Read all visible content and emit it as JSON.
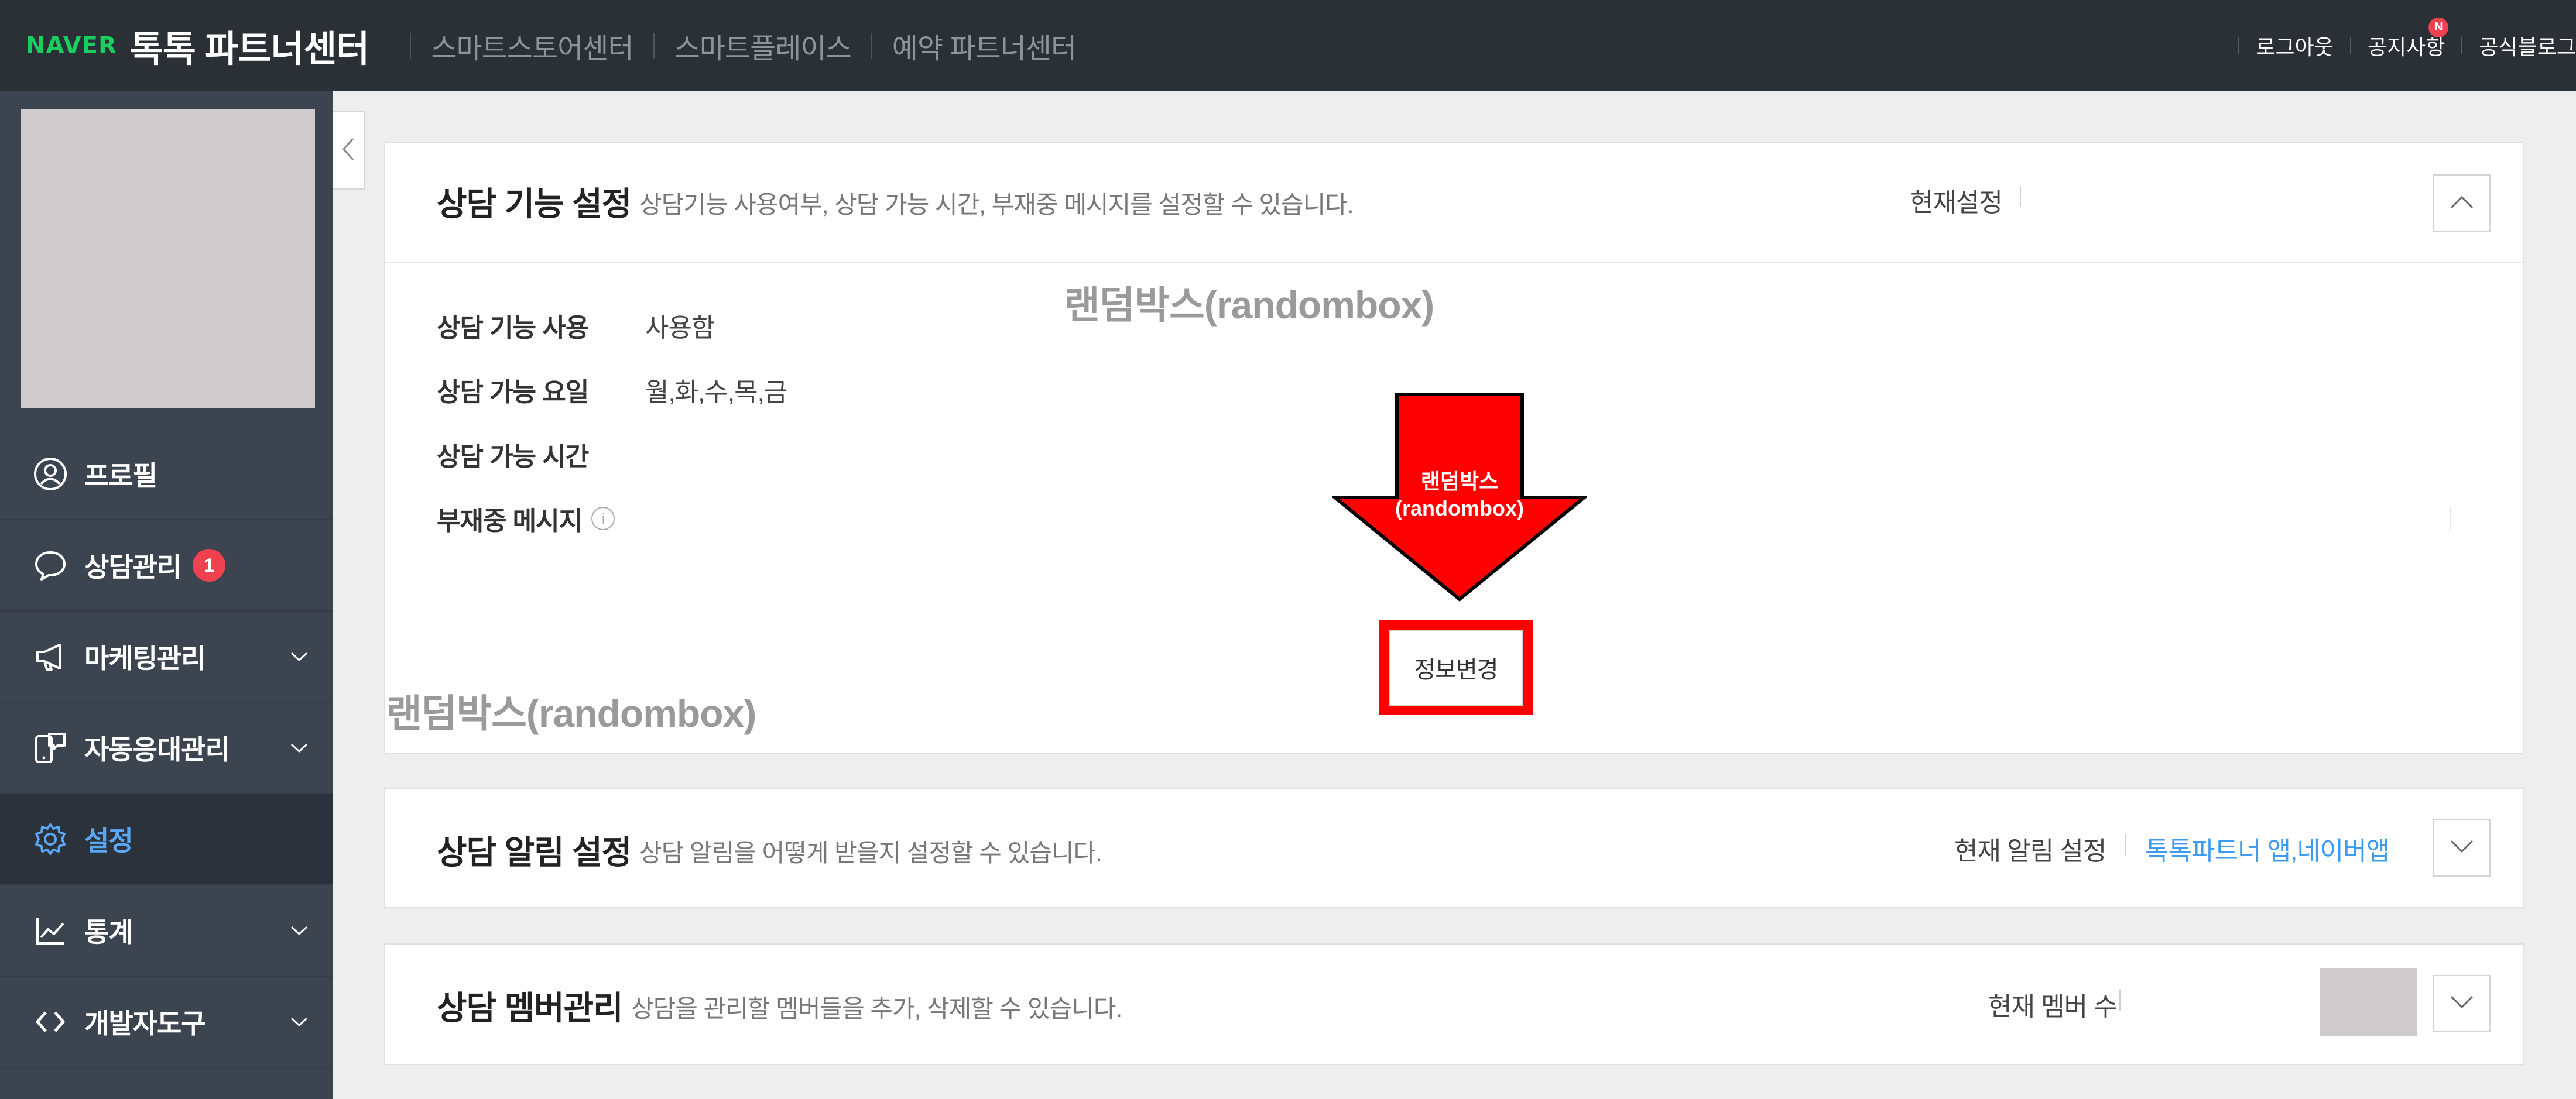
{
  "topbar": {
    "logo": "NAVER",
    "title": "톡톡 파트너센터",
    "nav": [
      "스마트스토어센터",
      "스마트플레이스",
      "예약 파트너센터"
    ],
    "links": {
      "logout": "로그아웃",
      "notice": "공지사항",
      "notice_badge": "N",
      "blog": "공식블로그"
    }
  },
  "sidebar": {
    "items": [
      {
        "label": "프로필",
        "icon": "user-icon"
      },
      {
        "label": "상담관리",
        "icon": "chat-icon",
        "count": "1"
      },
      {
        "label": "마케팅관리",
        "icon": "megaphone-icon"
      },
      {
        "label": "자동응대관리",
        "icon": "phone-chat-icon"
      },
      {
        "label": "설정",
        "icon": "gear-icon",
        "active": true
      },
      {
        "label": "통계",
        "icon": "chart-icon"
      },
      {
        "label": "개발자도구",
        "icon": "code-icon"
      }
    ]
  },
  "panel1": {
    "title": "상담 기능 설정",
    "desc": "상담기능 사용여부, 상담 가능 시간, 부재중 메시지를 설정할 수 있습니다.",
    "current_label": "현재설정",
    "fields": [
      {
        "label": "상담 기능 사용",
        "value": "사용함"
      },
      {
        "label": "상담 가능 요일",
        "value": "월,화,수,목,금"
      },
      {
        "label": "상담 가능 시간",
        "value": ""
      },
      {
        "label": "부재중 메시지",
        "value": ""
      }
    ],
    "info_icon_glyph": "i",
    "change_button": "정보변경"
  },
  "overlay": {
    "watermark_top": "랜덤박스(randombox)",
    "watermark_bottom": "랜덤박스(randombox)",
    "arrow_line1": "랜덤박스",
    "arrow_line2": "(randombox)",
    "arrow_color": "#ff0000",
    "highlight_color": "#ff0000"
  },
  "panel2": {
    "title": "상담 알림 설정",
    "desc": "상담 알림을 어떻게 받을지 설정할 수 있습니다.",
    "current_label": "현재 알림 설정",
    "current_value": "톡톡파트너 앱,네이버앱"
  },
  "panel3": {
    "title": "상담 멤버관리",
    "desc": "상담을 관리할 멤버들을 추가, 삭제할 수 있습니다.",
    "current_label": "현재 멤버 수"
  },
  "colors": {
    "topbar_bg": "#2b3036",
    "sidebar_bg": "#3c4450",
    "accent_blue": "#3d9bf0",
    "badge_red": "#f0414e",
    "naver_green": "#19ce60"
  }
}
